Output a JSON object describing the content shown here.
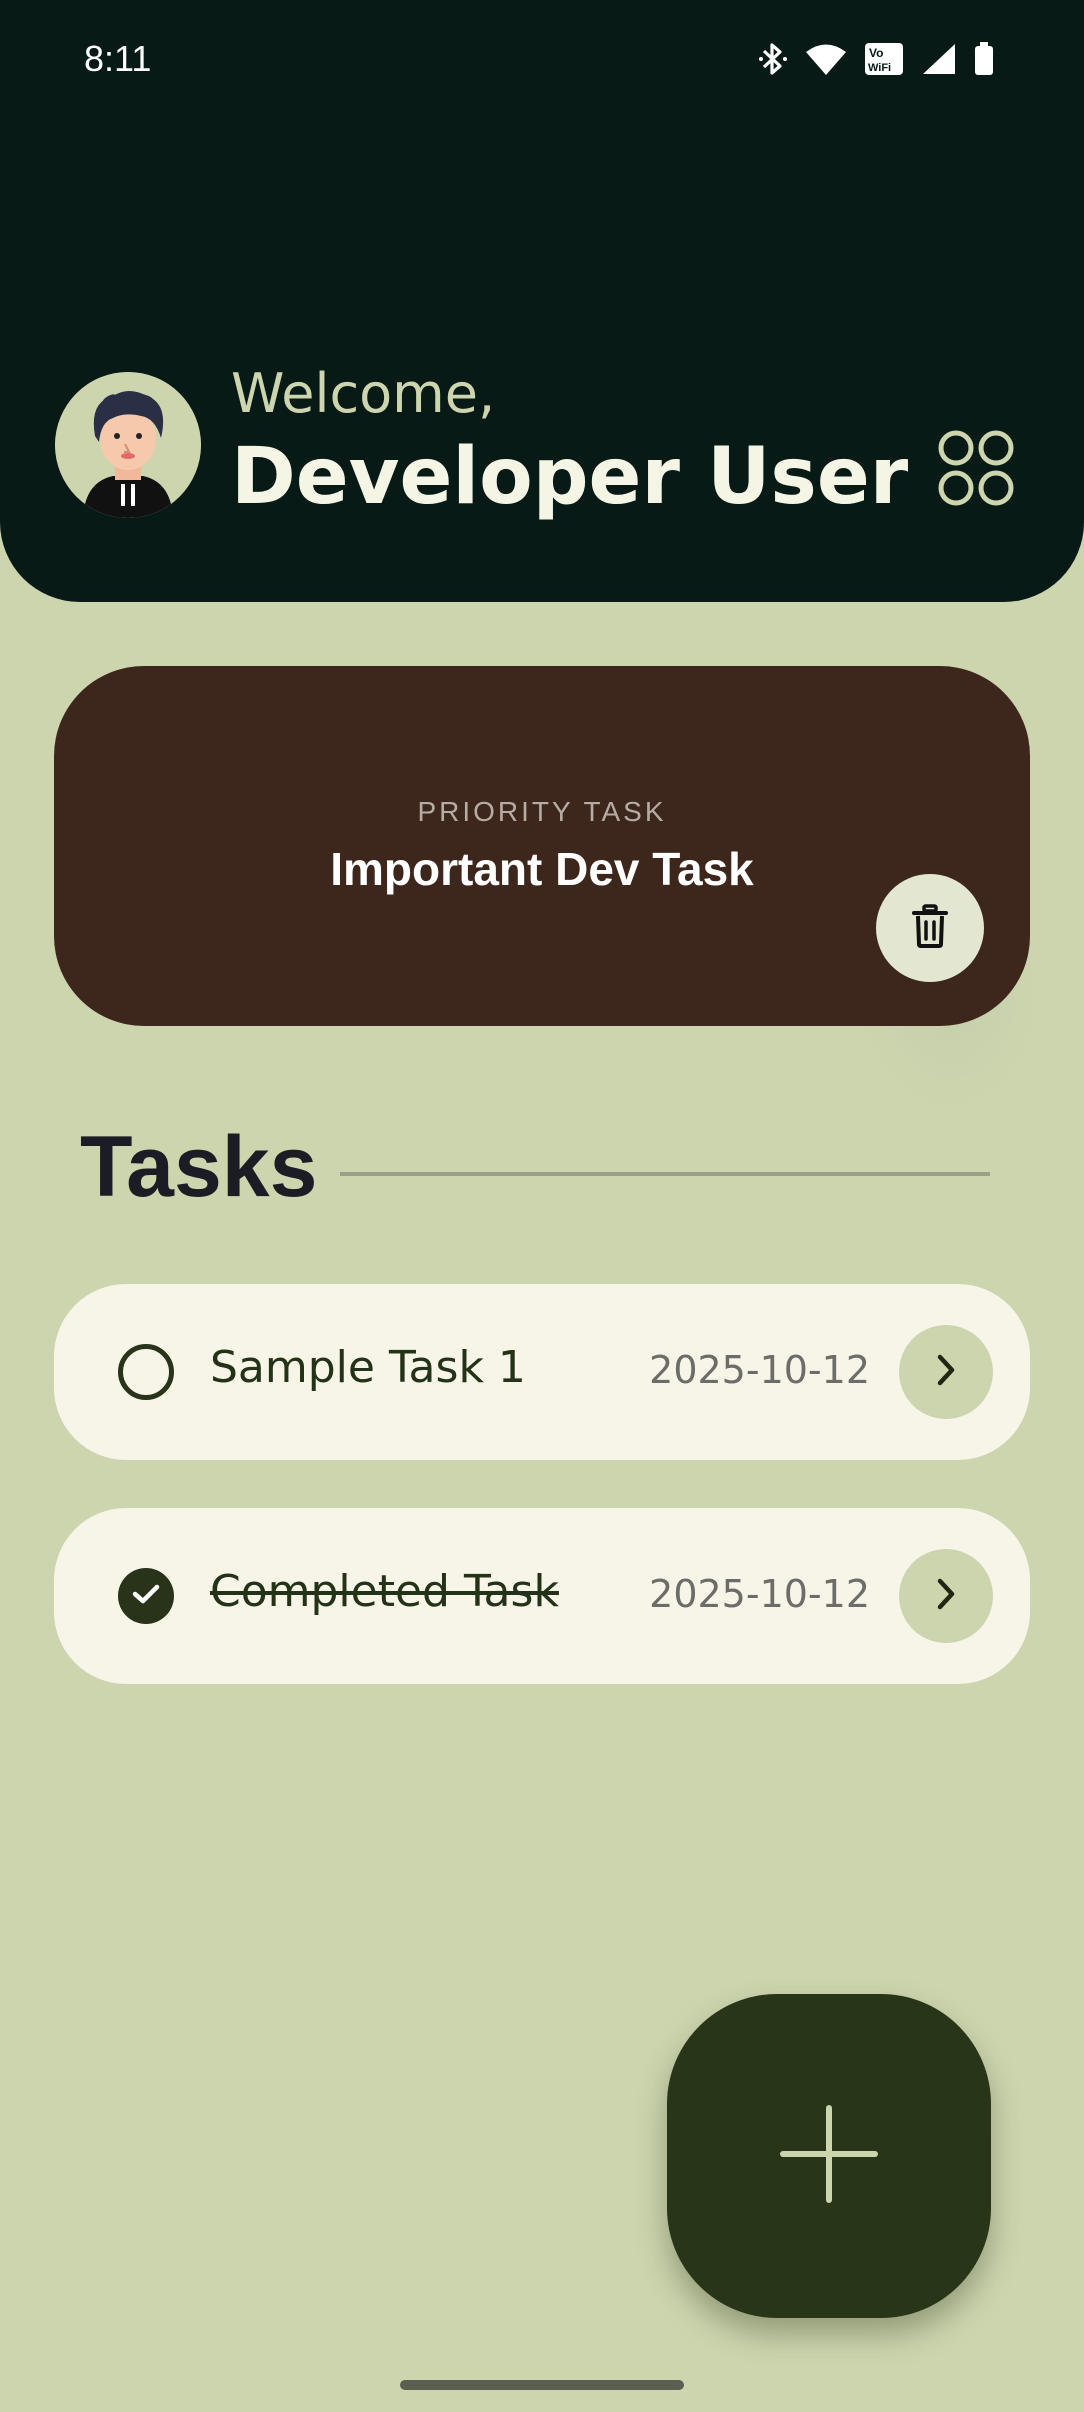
{
  "status_bar": {
    "time": "8:11",
    "icons": [
      "bluetooth-icon",
      "wifi-icon",
      "vowifi-icon",
      "cell-signal-icon",
      "battery-icon"
    ],
    "vowifi_top": "Vo",
    "vowifi_bottom": "WiFi"
  },
  "header": {
    "greeting": "Welcome,",
    "user_name": "Developer User",
    "avatar_icon": "user-avatar",
    "menu_icon": "grid-menu-icon"
  },
  "priority": {
    "label": "PRIORITY TASK",
    "title": "Important Dev Task",
    "delete_icon": "trash-icon"
  },
  "tasks": {
    "section_title": "Tasks",
    "items": [
      {
        "name": "Sample Task 1",
        "date": "2025-10-12",
        "completed": false
      },
      {
        "name": "Completed Task",
        "date": "2025-10-12",
        "completed": true
      }
    ]
  },
  "fab": {
    "icon": "plus-icon"
  },
  "colors": {
    "background": "#cdd5af",
    "header": "#081a16",
    "priority_card": "#3d271c",
    "task_card": "#f6f5e8",
    "accent_dark": "#293518",
    "greeting": "#cdd5af"
  }
}
